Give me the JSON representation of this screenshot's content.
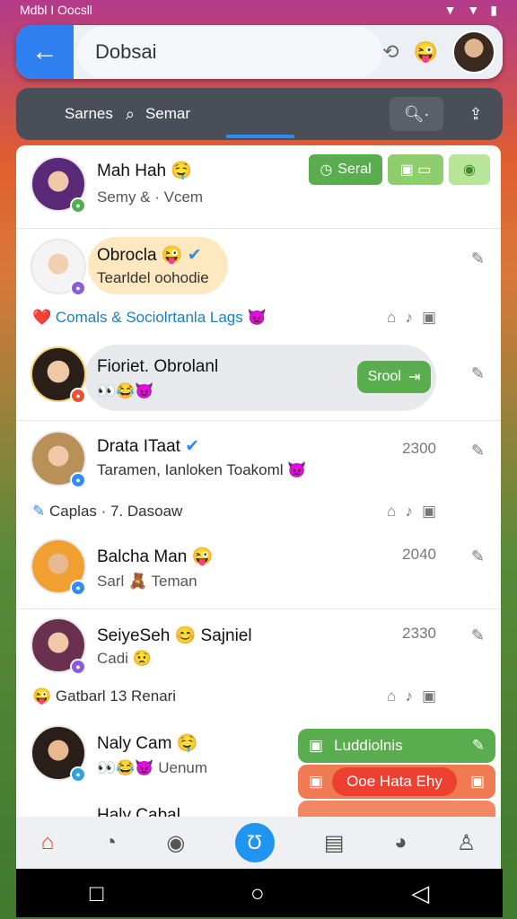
{
  "status_bar": {
    "carrier": "Mdbl I Oocsll"
  },
  "header": {
    "search_value": "Dobsai",
    "back_icon": "arrow-left-icon",
    "emoji": "😜"
  },
  "tabs": {
    "label": "Sarnes",
    "search_label": "Semar"
  },
  "chats": [
    {
      "name": "Mah Hah 🤤",
      "preview": "Semy & · Vcem",
      "actions": {
        "primary": "Seral"
      }
    },
    {
      "name": "Obrocla 😜",
      "preview": "Tearldel oohodie"
    },
    {
      "name": "Fioriet. Obrolanl",
      "preview": "👀😂😈",
      "action": "Srool"
    },
    {
      "name": "Drata ITaat",
      "preview": "Taramen, Ianloken Toakoml 👿",
      "time": "2300"
    },
    {
      "name": "Balcha Man 😜",
      "preview": "Sarl 🧸 Teman",
      "time": "2040"
    },
    {
      "name": "SeiyeSeh 😊 Sajniel",
      "preview": "Cadi 😟",
      "time": "2330"
    },
    {
      "name": "Naly Cam 🤤",
      "preview": "👀😂😈 Uenum"
    },
    {
      "name": "Haly Cabal"
    }
  ],
  "groups": [
    {
      "label": "Comals & Sociolrtanla Lags 👿",
      "icon": "❤️"
    },
    {
      "label": "Caplas · 7. Dasoaw"
    },
    {
      "label": "Gatbarl 13 Renari",
      "icon": "😜"
    }
  ],
  "popup": {
    "item1": "Luddiolnis",
    "item2": "Ooe Hata Ehy"
  },
  "colors": {
    "accent": "#2f7ff0",
    "green": "#5aad4e",
    "orange": "#f07a52",
    "red": "#ee4030"
  }
}
